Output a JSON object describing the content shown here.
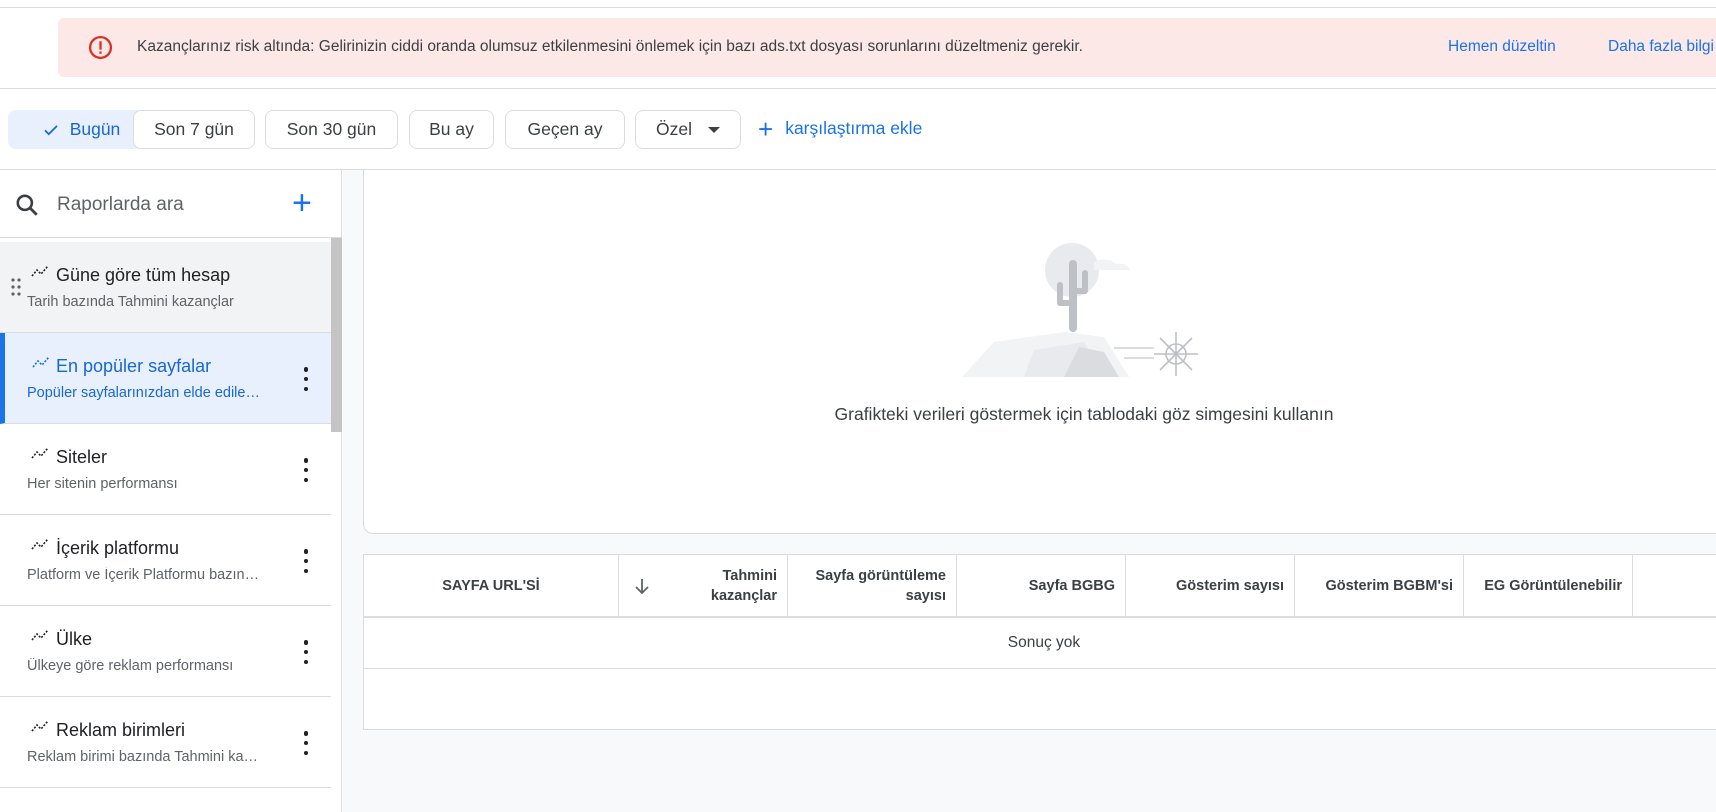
{
  "alert": {
    "message": "Kazançlarınız risk altında: Gelirinizin ciddi oranda olumsuz etkilenmesini önlemek için bazı ads.txt dosyası sorunlarını düzeltmeniz gerekir.",
    "fix_link": "Hemen düzeltin",
    "more_link": "Daha fazla bilgi",
    "icon": "error-icon"
  },
  "date_chips": [
    {
      "label": "Bugün",
      "selected": true
    },
    {
      "label": "Son 7 gün",
      "selected": false
    },
    {
      "label": "Son 30 gün",
      "selected": false
    },
    {
      "label": "Bu ay",
      "selected": false
    },
    {
      "label": "Geçen ay",
      "selected": false
    },
    {
      "label": "Özel",
      "selected": false
    }
  ],
  "add_comparison": "karşılaştırma ekle",
  "search": {
    "placeholder": "Raporlarda ara"
  },
  "reports": [
    {
      "title": "Güne göre tüm hesap",
      "subtitle": "Tarih bazında Tahmini kazançlar"
    },
    {
      "title": "En popüler sayfalar",
      "subtitle": "Popüler sayfalarınızdan elde edilen kazançlar"
    },
    {
      "title": "Siteler",
      "subtitle": "Her sitenin performansı"
    },
    {
      "title": "İçerik platformu",
      "subtitle": "Platform ve İçerik Platformu bazında performans"
    },
    {
      "title": "Ülke",
      "subtitle": "Ülkeye göre reklam performansı"
    },
    {
      "title": "Reklam birimleri",
      "subtitle": "Reklam birimi bazında Tahmini kazançlar"
    }
  ],
  "chart_empty": {
    "message": "Grafikteki verileri göstermek için tablodaki göz simgesini kullanın"
  },
  "table": {
    "columns": [
      "SAYFA URL'Sİ",
      "Tahmini kazançlar",
      "Sayfa görüntüleme sayısı",
      "Sayfa BGBG",
      "Gösterim sayısı",
      "Gösterim BGBM'si",
      "EG Görüntülenebilir"
    ],
    "empty_text": "Sonuç yok"
  },
  "colors": {
    "accent": "#1a73e8",
    "alert_bg": "#fce8e6",
    "alert_icon": "#d93025",
    "selected_chip_bg": "#e8f0fe"
  }
}
